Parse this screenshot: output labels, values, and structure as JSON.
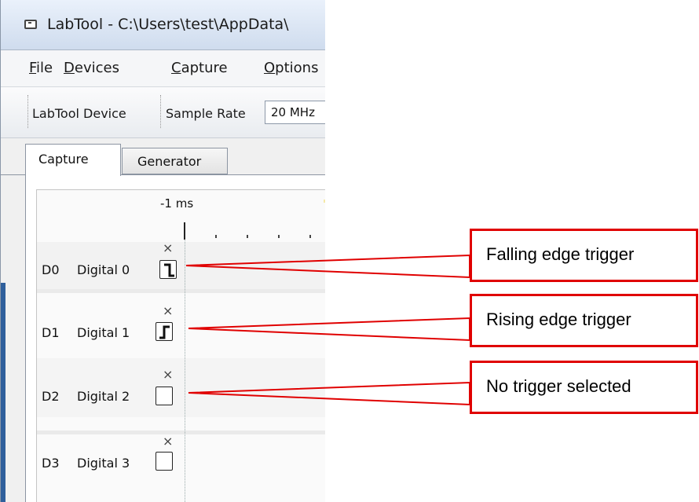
{
  "window": {
    "title": "LabTool - C:\\Users\\test\\AppData\\"
  },
  "menu": [
    {
      "label": "File",
      "mnemonic": "F",
      "rest": "ile"
    },
    {
      "label": "Devices",
      "mnemonic": "D",
      "rest": "evices"
    },
    {
      "label": "Capture",
      "mnemonic": "C",
      "rest": "apture"
    },
    {
      "label": "Options",
      "mnemonic": "O",
      "rest": "ptions"
    }
  ],
  "toolbar": {
    "device_label": "LabTool Device",
    "sample_rate_label": "Sample Rate",
    "sample_rate_value": "20 MHz"
  },
  "tabs": [
    {
      "label": "Capture",
      "active": true
    },
    {
      "label": "Generator",
      "active": false
    }
  ],
  "ruler": {
    "time_label": "-1 ms"
  },
  "channels": [
    {
      "id": "D0",
      "name": "Digital 0",
      "remove": "×",
      "trigger": "falling"
    },
    {
      "id": "D1",
      "name": "Digital 1",
      "remove": "×",
      "trigger": "rising"
    },
    {
      "id": "D2",
      "name": "Digital 2",
      "remove": "×",
      "trigger": "none"
    },
    {
      "id": "D3",
      "name": "Digital 3",
      "remove": "×",
      "trigger": "none"
    }
  ],
  "callouts": [
    {
      "text": "Falling edge trigger"
    },
    {
      "text": "Rising edge trigger"
    },
    {
      "text": "No trigger selected"
    }
  ],
  "colors": {
    "callout_border": "#e00000",
    "callout_line": "#e00000"
  }
}
